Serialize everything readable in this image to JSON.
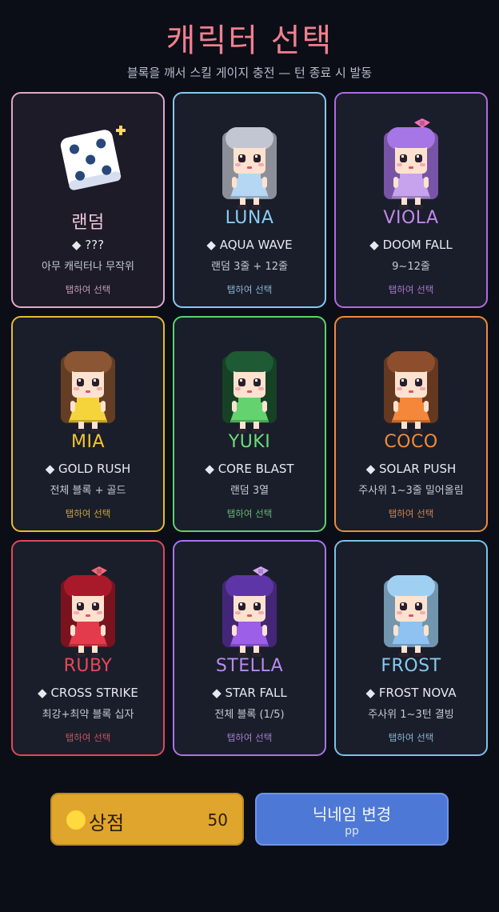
{
  "header": {
    "title": "캐릭터 선택",
    "subtitle": "블록을 깨서 스킬 게이지 충전 — 턴 종료 시 발동"
  },
  "cards": [
    {
      "id": "random",
      "name": "랜덤",
      "skill": "◆ ???",
      "desc": "아무 캐릭터나 무작위",
      "tap": "탭하여 선택",
      "color": "#e0a8c8",
      "name_color": "#f2c6dc",
      "tap_color": "#c79ab5",
      "icon": "dice-icon"
    },
    {
      "id": "luna",
      "name": "LUNA",
      "skill": "◆ AQUA WAVE",
      "desc": "랜덤 3줄 + 12줄",
      "tap": "탭하여 선택",
      "color": "#86c7f0",
      "name_color": "#8ccaf0",
      "tap_color": "#86b6d2",
      "hair": "#c2c6d2",
      "dress": "#b6d7f4"
    },
    {
      "id": "viola",
      "name": "VIOLA",
      "skill": "◆ DOOM FALL",
      "desc": "9~12줄",
      "tap": "탭하여 선택",
      "color": "#b06ae0",
      "name_color": "#c189ec",
      "tap_color": "#a876cf",
      "hair": "#a675e6",
      "dress": "#c6a3ec",
      "bow": "#f070b6"
    },
    {
      "id": "mia",
      "name": "MIA",
      "skill": "◆ GOLD RUSH",
      "desc": "전체 블록 + 골드",
      "tap": "탭하여 선택",
      "color": "#e7bc2e",
      "name_color": "#f2c531",
      "tap_color": "#c9a437",
      "hair": "#8a5633",
      "dress": "#f5d33b"
    },
    {
      "id": "yuki",
      "name": "YUKI",
      "skill": "◆ CORE BLAST",
      "desc": "랜덤 3열",
      "tap": "탭하여 선택",
      "color": "#5cd26c",
      "name_color": "#6bdc7b",
      "tap_color": "#62b874",
      "hair": "#1e5a33",
      "dress": "#64d26f"
    },
    {
      "id": "coco",
      "name": "COCO",
      "skill": "◆ SOLAR PUSH",
      "desc": "주사위 1~3줄 밀어올림",
      "tap": "탭하여 선택",
      "color": "#ee8a3a",
      "name_color": "#f08c3c",
      "tap_color": "#cf834a",
      "hair": "#8c4e2c",
      "dress": "#f5873a"
    },
    {
      "id": "ruby",
      "name": "RUBY",
      "skill": "◆ CROSS STRIKE",
      "desc": "최강+최약 블록 십자",
      "tap": "탭하여 선택",
      "color": "#e0485a",
      "name_color": "#e8475a",
      "tap_color": "#c4525f",
      "hair": "#a81a2a",
      "dress": "#e33b4b",
      "bow": "#f06a7c"
    },
    {
      "id": "stella",
      "name": "STELLA",
      "skill": "◆ STAR FALL",
      "desc": "전체 블록 (1/5)",
      "tap": "탭하여 선택",
      "color": "#a874ec",
      "name_color": "#b98af0",
      "tap_color": "#a17dd0",
      "hair": "#5e35a6",
      "dress": "#9c5fe8",
      "bow": "#d7a6f5"
    },
    {
      "id": "frost",
      "name": "FROST",
      "skill": "◆ FROST NOVA",
      "desc": "주사위 1~3턴 결빙",
      "tap": "탭하여 선택",
      "color": "#7cc1ea",
      "name_color": "#86caf0",
      "tap_color": "#84b4cf",
      "hair": "#9fd0f2",
      "dress": "#8fc2f0"
    }
  ],
  "footer": {
    "shop_label": "상점",
    "shop_count": "50",
    "nick_label": "닉네임 변경",
    "nick_value": "pp",
    "coin_color": "#ffd93d"
  }
}
